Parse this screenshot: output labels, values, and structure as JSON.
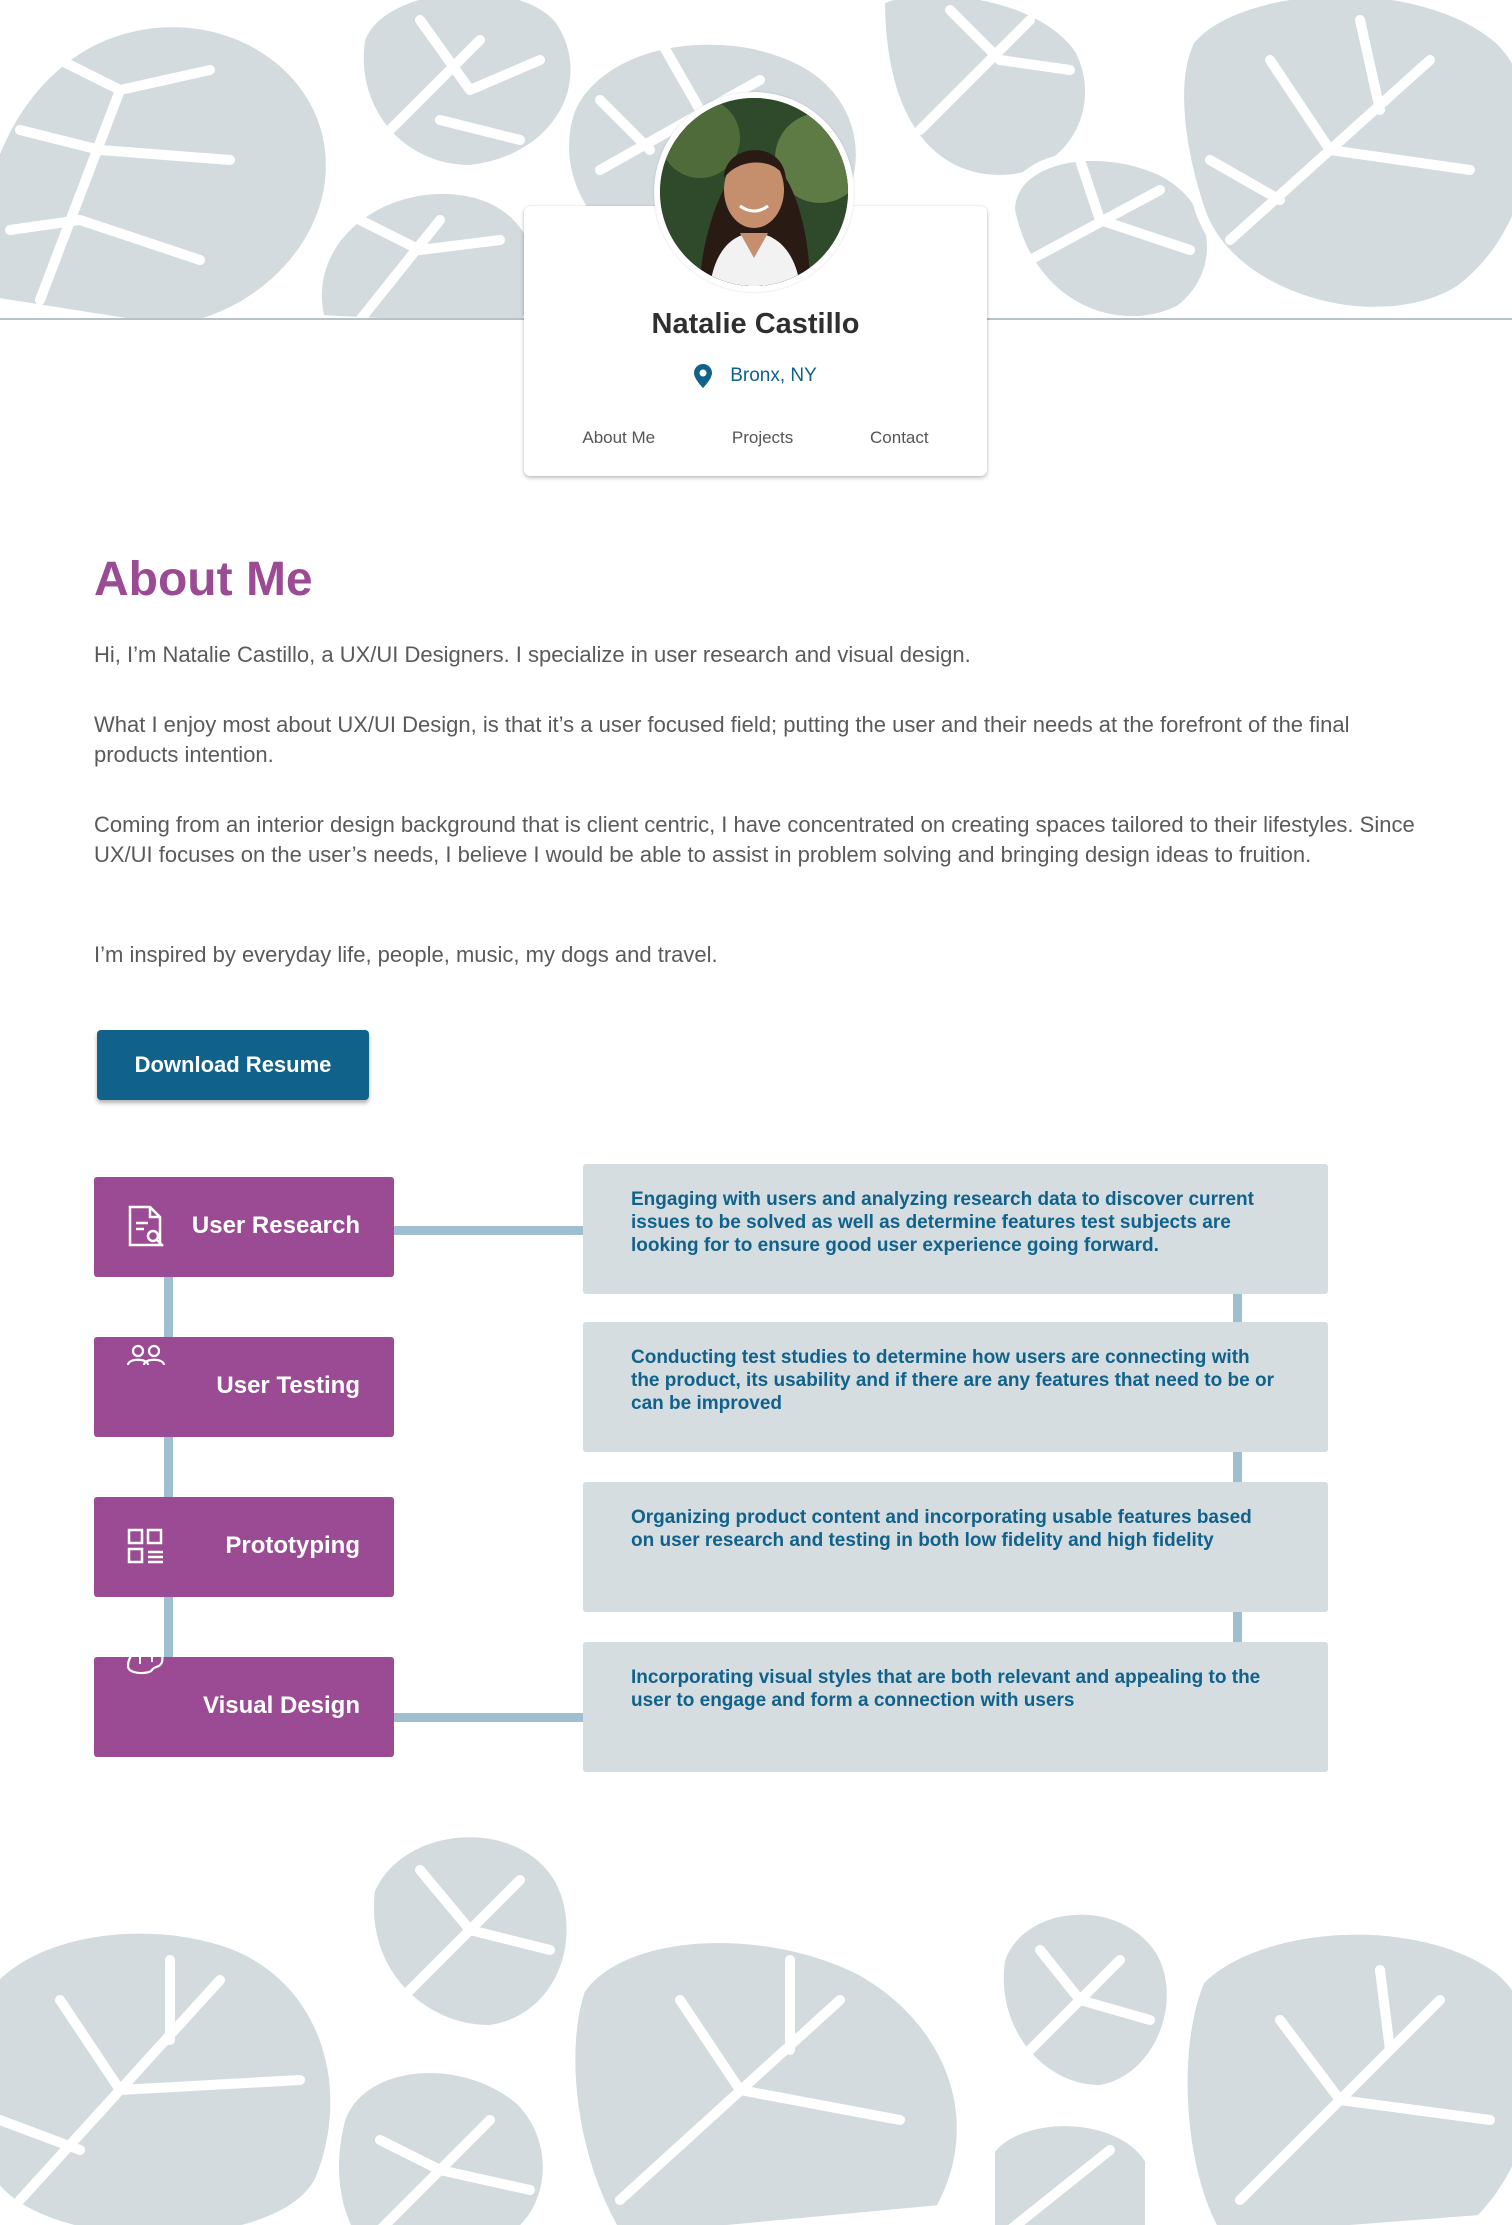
{
  "profile": {
    "name": "Natalie Castillo",
    "location": "Bronx, NY",
    "location_icon": "map-pin-icon",
    "nav": [
      "About Me",
      "Projects",
      "Contact"
    ]
  },
  "about": {
    "title": "About Me",
    "paragraphs": [
      "Hi, I’m Natalie Castillo, a UX/UI Designers. I specialize in user research and visual design.",
      "What I enjoy most about UX/UI Design, is that it’s a user focused field; putting the user and their needs at the forefront of the final products intention.",
      "Coming from an interior design background that is client centric, I have concentrated on creating spaces tailored to their lifestyles. Since UX/UI focuses on the user’s needs, I believe I would be able to assist in problem solving and bringing design ideas to fruition.",
      "I’m inspired by everyday life, people, music, my dogs and travel."
    ],
    "download_button": "Download Resume"
  },
  "skills": [
    {
      "label": "User Research",
      "icon": "research-document-icon",
      "description": "Engaging with users and analyzing research data to discover current issues to be solved as well as determine features test subjects are looking for to ensure good user experience going forward."
    },
    {
      "label": "User Testing",
      "icon": "users-icon",
      "description": "Conducting test studies to determine how users are connecting with the product, its usability and if there are any features that need to be or can be improved"
    },
    {
      "label": "Prototyping",
      "icon": "layout-grid-icon",
      "description": "Organizing product content and incorporating usable features based on user research and testing in both low fidelity and high fidelity"
    },
    {
      "label": "Visual Design",
      "icon": "palette-icon",
      "description": "Incorporating visual styles that are both relevant and appealing to the user to engage and form a connection with users"
    }
  ],
  "colors": {
    "accent_purple": "#9a4b93",
    "accent_blue": "#10628b",
    "leaf_gray": "#d3dbdf",
    "panel_gray": "#d6dde0",
    "connector_blue": "#9fbfd0"
  }
}
